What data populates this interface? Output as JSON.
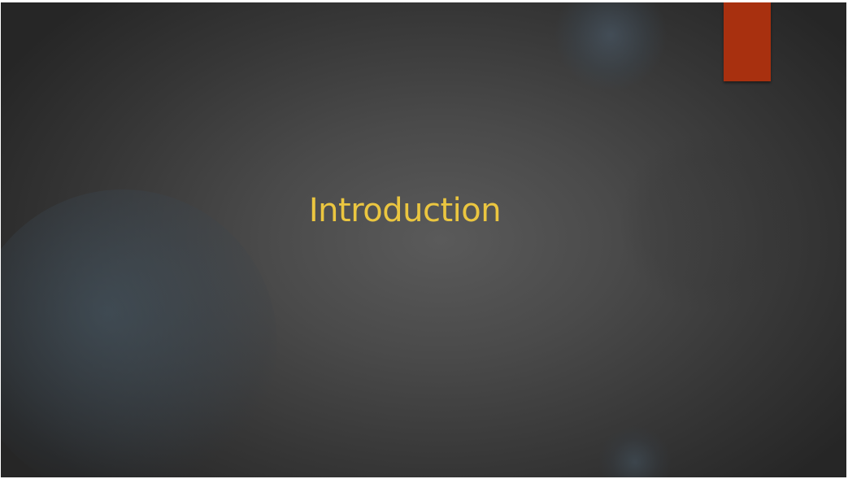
{
  "slide": {
    "title": "Introduction",
    "colors": {
      "title_text": "#ebc640",
      "accent_tab": "#a8300f",
      "background_center": "#5a5a5a",
      "background_edge": "#262626"
    },
    "decorations": [
      "accent-tab",
      "bokeh-circles"
    ]
  }
}
